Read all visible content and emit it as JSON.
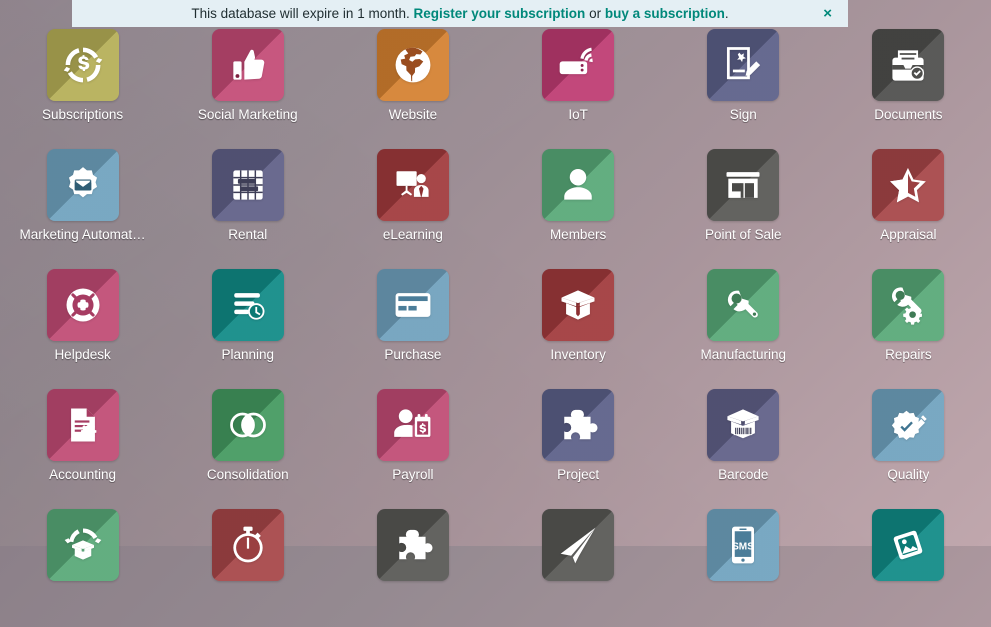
{
  "alert": {
    "message_prefix": "This database will expire in 1 month.",
    "link_register": "Register your subscription",
    "conjunction": "or",
    "link_buy": "buy a subscription",
    "suffix": ".",
    "close_label": "×",
    "background": "#e4eff4",
    "link_color": "#00887a"
  },
  "desktop": {
    "background_from": "#8c8089",
    "background_to": "#c0a7ad"
  },
  "apps": [
    {
      "label": "Subscriptions",
      "icon": "subscriptions-icon",
      "color": "#b5ae56"
    },
    {
      "label": "Social Marketing",
      "icon": "thumbs-up-icon",
      "color": "#c34a75"
    },
    {
      "label": "Website",
      "icon": "globe-icon",
      "color": "#d4802f"
    },
    {
      "label": "IoT",
      "icon": "iot-wifi-box-icon",
      "color": "#bd3a71"
    },
    {
      "label": "Sign",
      "icon": "sign-document-pen-icon",
      "color": "#5b5f88"
    },
    {
      "label": "Documents",
      "icon": "documents-tray-icon",
      "color": "#4e4e4c"
    },
    {
      "label": "Marketing Automat…",
      "icon": "gear-envelope-icon",
      "color": "#6fa2be"
    },
    {
      "label": "Rental",
      "icon": "rental-grid-icon",
      "color": "#5f5f87"
    },
    {
      "label": "eLearning",
      "icon": "elearning-board-icon",
      "color": "#a0393b"
    },
    {
      "label": "Members",
      "icon": "person-icon",
      "color": "#57a877"
    },
    {
      "label": "Point of Sale",
      "icon": "storefront-icon",
      "color": "#575754"
    },
    {
      "label": "Appraisal",
      "icon": "star-half-icon",
      "color": "#a64547"
    },
    {
      "label": "Helpdesk",
      "icon": "lifebuoy-icon",
      "color": "#c04a73"
    },
    {
      "label": "Planning",
      "icon": "planning-clock-icon",
      "color": "#0f8a86"
    },
    {
      "label": "Purchase",
      "icon": "credit-card-icon",
      "color": "#6fa0bc"
    },
    {
      "label": "Inventory",
      "icon": "open-box-icon",
      "color": "#a0393b"
    },
    {
      "label": "Manufacturing",
      "icon": "wrench-icon",
      "color": "#57a877"
    },
    {
      "label": "Repairs",
      "icon": "wrench-gear-icon",
      "color": "#57a877"
    },
    {
      "label": "Accounting",
      "icon": "document-gear-icon",
      "color": "#c04a73"
    },
    {
      "label": "Consolidation",
      "icon": "venn-circles-icon",
      "color": "#43995f"
    },
    {
      "label": "Payroll",
      "icon": "person-money-icon",
      "color": "#c04a73"
    },
    {
      "label": "Project",
      "icon": "puzzle-piece-icon",
      "color": "#5b5f88"
    },
    {
      "label": "Barcode",
      "icon": "barcode-box-icon",
      "color": "#5f5f87"
    },
    {
      "label": "Quality",
      "icon": "quality-badge-pen-icon",
      "color": "#6fa2be"
    },
    {
      "label": "",
      "icon": "recycle-box-icon",
      "color": "#57a877"
    },
    {
      "label": "",
      "icon": "stopwatch-icon",
      "color": "#a64547"
    },
    {
      "label": "",
      "icon": "puzzle-piece-icon",
      "color": "#575754"
    },
    {
      "label": "",
      "icon": "paper-plane-icon",
      "color": "#575754"
    },
    {
      "label": "",
      "icon": "sms-phone-icon",
      "color": "#6fa2be"
    },
    {
      "label": "",
      "icon": "photo-tilt-icon",
      "color": "#0f8a86"
    }
  ]
}
